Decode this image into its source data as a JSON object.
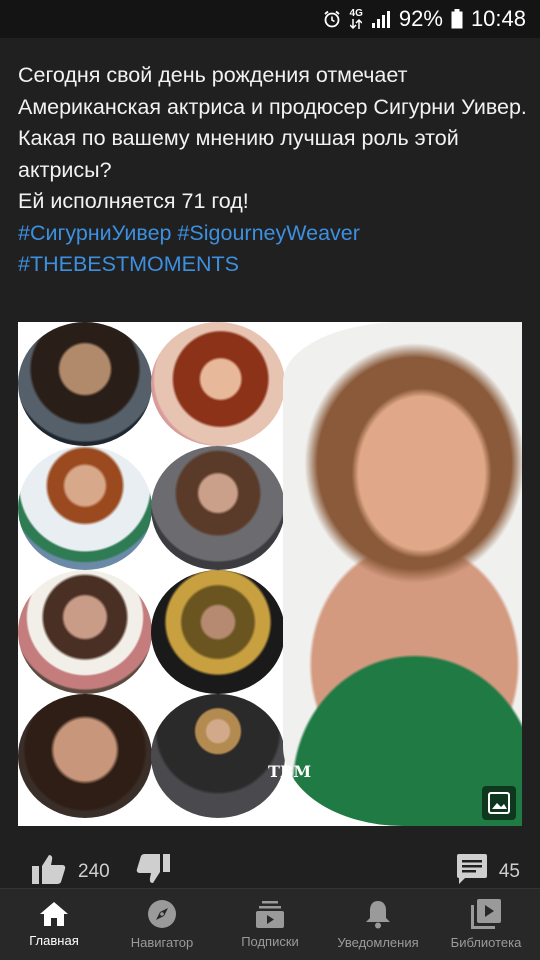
{
  "status_bar": {
    "network": "4G",
    "battery": "92%",
    "time": "10:48",
    "icons": [
      "alarm-icon",
      "data-arrows-icon",
      "signal-icon",
      "battery-icon"
    ]
  },
  "post": {
    "lines": [
      "Сегодня свой день рождения отмечает Американская актриса и продюсер Сигурни Уивер.",
      "Какая по вашему мнению лучшая роль этой актрисы?",
      "Ей исполняется 71 год!"
    ],
    "hashtags": [
      "#СигурниУивер",
      "#SigourneyWeaver",
      "#THEBESTMOMENTS"
    ]
  },
  "image": {
    "watermark": "TBM",
    "badge_icon": "image-icon"
  },
  "actions": {
    "likes": "240",
    "comments": "45",
    "icons": [
      "like-icon",
      "dislike-icon",
      "comment-icon"
    ]
  },
  "nav": {
    "items": [
      {
        "label": "Главная",
        "icon": "home-icon",
        "active": true
      },
      {
        "label": "Навигатор",
        "icon": "compass-icon",
        "active": false
      },
      {
        "label": "Подписки",
        "icon": "subscriptions-icon",
        "active": false
      },
      {
        "label": "Уведомления",
        "icon": "bell-icon",
        "active": false
      },
      {
        "label": "Библиотека",
        "icon": "library-icon",
        "active": false
      }
    ]
  },
  "colors": {
    "background": "#202020",
    "status_bar": "#141414",
    "hashtag": "#3d8fe0",
    "nav_bar": "#282828"
  }
}
